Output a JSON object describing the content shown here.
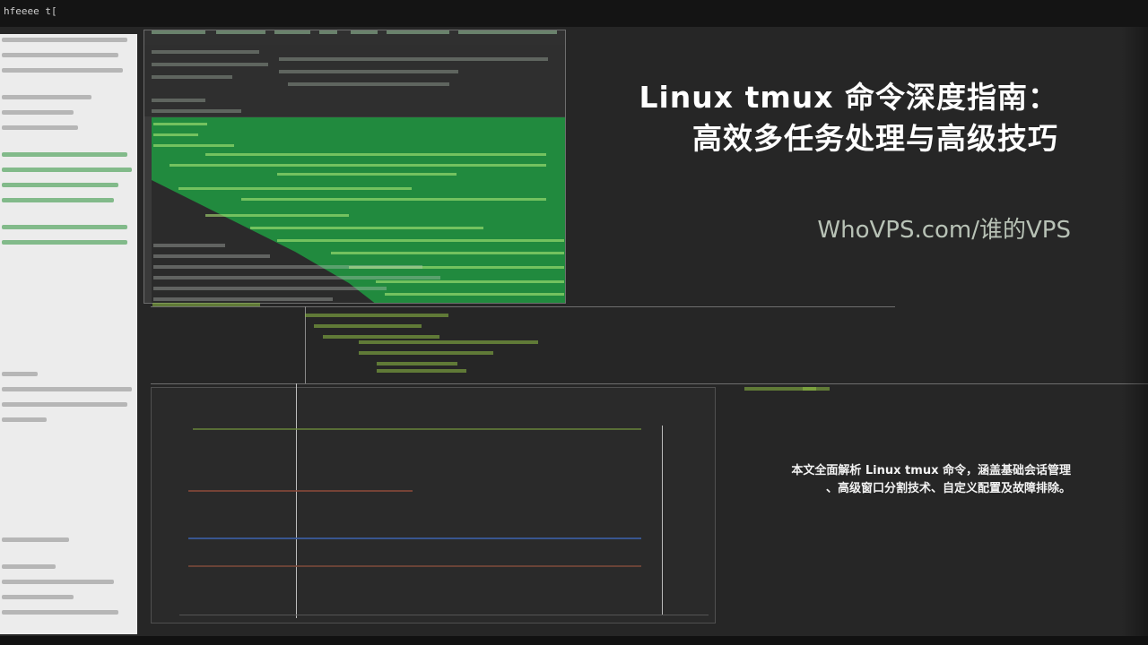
{
  "window": {
    "title": "hfeeee t["
  },
  "headline": {
    "line1": "Linux tmux 命令深度指南：",
    "line2": "高效多任务处理与高级技巧"
  },
  "site": {
    "label": "WhoVPS.com/谁的VPS"
  },
  "description": {
    "line1": "本文全面解析 Linux tmux 命令，涵盖基础会话管理",
    "line2": "、高级窗口分割技术、自定义配置及故障排除。"
  },
  "colors": {
    "background": "#262626",
    "terminal_green": "#218a3e",
    "title_text": "#ffffff",
    "site_text": "#b8c2b6"
  }
}
